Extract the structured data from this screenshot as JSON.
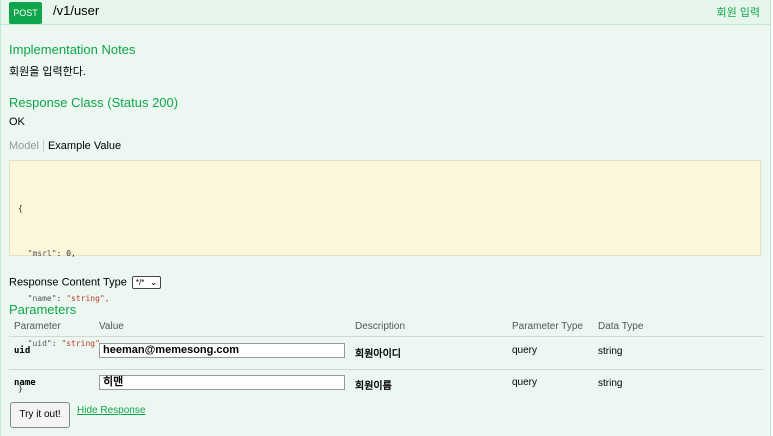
{
  "endpoint": {
    "method": "POST",
    "path": "/v1/user",
    "summary": "회원 입력",
    "accent_color": "#10a54a",
    "background": "#ebf7f0"
  },
  "implementation_notes": {
    "title": "Implementation Notes",
    "text": "회원을 입력한다."
  },
  "response_class": {
    "title": "Response Class (Status 200)",
    "text": "OK"
  },
  "tabs": {
    "model": "Model",
    "example": "Example Value",
    "active": "Example Value"
  },
  "example_json": {
    "open": "{",
    "lines": [
      {
        "key": "\"msrl\"",
        "value": "0,",
        "type": "number"
      },
      {
        "key": "\"name\"",
        "value": "\"string\",",
        "type": "string"
      },
      {
        "key": "\"uid\"",
        "value": "\"string\"",
        "type": "string"
      }
    ],
    "close": "}"
  },
  "response_content_type": {
    "label": "Response Content Type",
    "selected": "*/*"
  },
  "parameters": {
    "title": "Parameters",
    "headers": {
      "parameter": "Parameter",
      "value": "Value",
      "description": "Description",
      "parameter_type": "Parameter Type",
      "data_type": "Data Type"
    },
    "rows": [
      {
        "name": "uid",
        "value": "heeman@memesong.com",
        "description": "회원아이디",
        "parameter_type": "query",
        "data_type": "string"
      },
      {
        "name": "name",
        "value": "히맨",
        "description": "회원이름",
        "parameter_type": "query",
        "data_type": "string"
      }
    ]
  },
  "actions": {
    "try_label": "Try it out!",
    "hide_label": "Hide Response"
  }
}
